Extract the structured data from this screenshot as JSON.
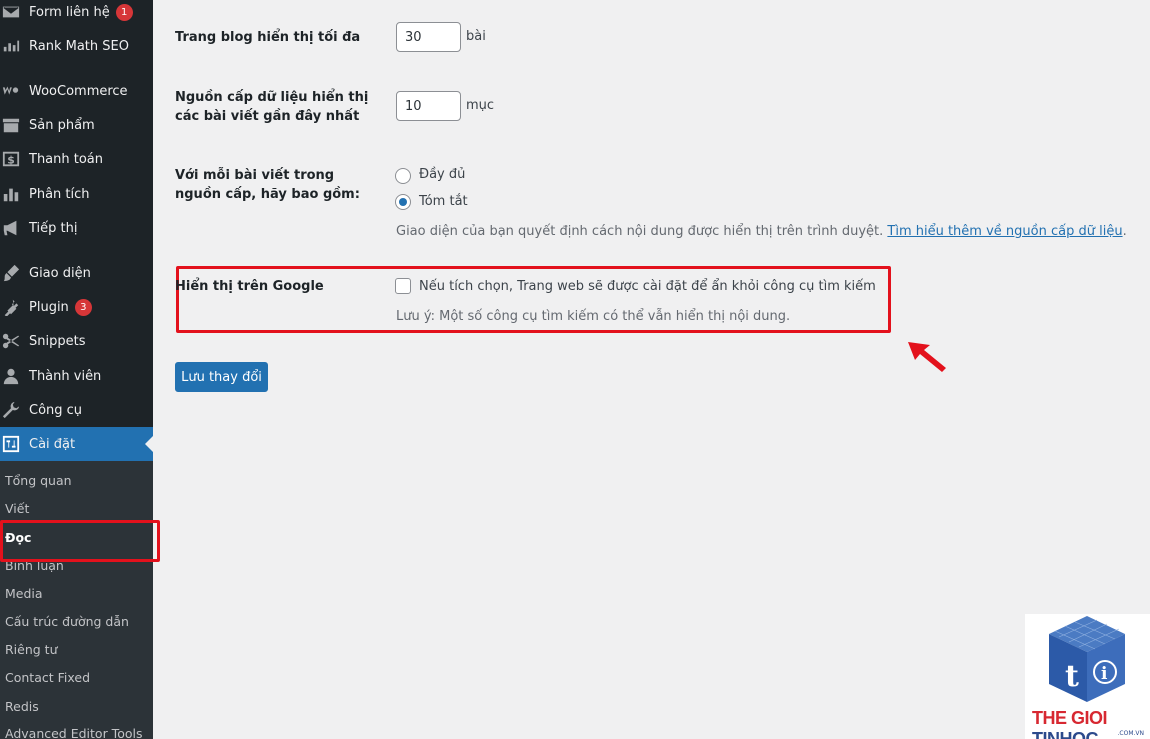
{
  "sidebar": {
    "items": [
      {
        "label": "Form liên hệ",
        "badge": "1",
        "icon": "envelope-icon"
      },
      {
        "label": "Rank Math SEO",
        "icon": "chart-icon"
      },
      {
        "label": "WooCommerce",
        "icon": "woo-icon"
      },
      {
        "label": "Sản phẩm",
        "icon": "archive-icon"
      },
      {
        "label": "Thanh toán",
        "icon": "dollar-icon"
      },
      {
        "label": "Phân tích",
        "icon": "bar-chart-icon"
      },
      {
        "label": "Tiếp thị",
        "icon": "megaphone-icon"
      },
      {
        "label": "Giao diện",
        "icon": "brush-icon"
      },
      {
        "label": "Plugin",
        "badge": "3",
        "icon": "plug-icon"
      },
      {
        "label": "Snippets",
        "icon": "scissors-icon"
      },
      {
        "label": "Thành viên",
        "icon": "user-icon"
      },
      {
        "label": "Công cụ",
        "icon": "wrench-icon"
      },
      {
        "label": "Cài đặt",
        "icon": "settings-icon"
      }
    ],
    "submenu": [
      "Tổng quan",
      "Viết",
      "Đọc",
      "Bình luận",
      "Media",
      "Cấu trúc đường dẫn",
      "Riêng tư",
      "Contact Fixed",
      "Redis",
      "Advanced Editor Tools"
    ]
  },
  "form": {
    "blog_pages": {
      "label": "Trang blog hiển thị tối đa",
      "value": "30",
      "unit": "bài"
    },
    "feed_items": {
      "label": "Nguồn cấp dữ liệu hiển thị các bài viết gần đây nhất",
      "value": "10",
      "unit": "mục"
    },
    "feed_content": {
      "label": "Với mỗi bài viết trong nguồn cấp, hãy bao gồm:",
      "options": [
        "Đầy đủ",
        "Tóm tắt"
      ],
      "selected": "Tóm tắt",
      "desc": "Giao diện của bạn quyết định cách nội dung được hiển thị trên trình duyệt.",
      "link": "Tìm hiểu thêm về nguồn cấp dữ liệu",
      "after": "."
    },
    "visibility": {
      "label": "Hiển thị trên Google",
      "checkbox_label": "Nếu tích chọn, Trang web sẽ được cài đặt để ẩn khỏi công cụ tìm kiếm",
      "note": "Lưu ý: Một số công cụ tìm kiếm có thể vẫn hiển thị nội dung."
    },
    "save_label": "Lưu thay đổi"
  },
  "logo": {
    "text_a": "THE GIOI",
    "text_b": "TINHOC",
    "domain": ".COM.VN"
  },
  "colors": {
    "accent": "#2271b1",
    "sidebar": "#1d2327",
    "highlight": "#e3111c"
  }
}
